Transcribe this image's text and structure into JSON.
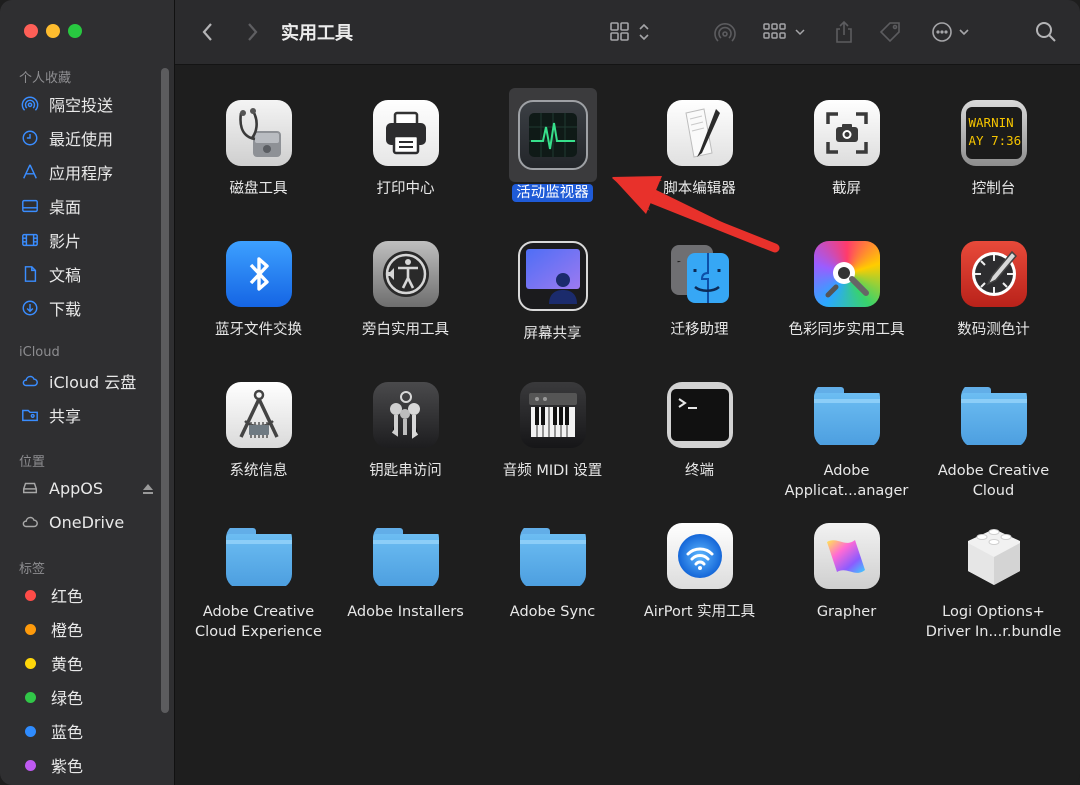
{
  "toolbar": {
    "title": "实用工具"
  },
  "sidebar": {
    "sections": {
      "favorites": "个人收藏",
      "icloud": "iCloud",
      "locations": "位置",
      "tags": "标签"
    },
    "favorites": [
      {
        "label": "隔空投送",
        "icon": "airdrop-icon"
      },
      {
        "label": "最近使用",
        "icon": "clock-icon"
      },
      {
        "label": "应用程序",
        "icon": "apps-icon"
      },
      {
        "label": "桌面",
        "icon": "desktop-icon"
      },
      {
        "label": "影片",
        "icon": "film-icon"
      },
      {
        "label": "文稿",
        "icon": "document-icon"
      },
      {
        "label": "下载",
        "icon": "download-icon"
      }
    ],
    "icloud": [
      {
        "label": "iCloud 云盘",
        "icon": "cloud-icon"
      },
      {
        "label": "共享",
        "icon": "shared-folder-icon"
      }
    ],
    "locations": [
      {
        "label": "AppOS",
        "icon": "disk-icon"
      },
      {
        "label": "OneDrive",
        "icon": "cloud-icon"
      }
    ],
    "tags": [
      {
        "label": "红色",
        "color": "#fe4c48"
      },
      {
        "label": "橙色",
        "color": "#fe9a0b"
      },
      {
        "label": "黄色",
        "color": "#fed60a"
      },
      {
        "label": "绿色",
        "color": "#31c748"
      },
      {
        "label": "蓝色",
        "color": "#2f8cff"
      },
      {
        "label": "紫色",
        "color": "#bf5af2"
      }
    ]
  },
  "items": [
    {
      "label": "磁盘工具",
      "icon": "disk-utility-icon"
    },
    {
      "label": "打印中心",
      "icon": "printer-icon"
    },
    {
      "label": "活动监视器",
      "icon": "activity-monitor-icon",
      "selected": true
    },
    {
      "label": "脚本编辑器",
      "icon": "script-editor-icon"
    },
    {
      "label": "截屏",
      "icon": "screenshot-icon"
    },
    {
      "label": "控制台",
      "icon": "console-icon",
      "screen_text_1": "WARNIN",
      "screen_text_2": "AY 7:36"
    },
    {
      "label": "蓝牙文件交换",
      "icon": "bluetooth-icon"
    },
    {
      "label": "旁白实用工具",
      "icon": "voiceover-icon"
    },
    {
      "label": "屏幕共享",
      "icon": "screen-sharing-icon"
    },
    {
      "label": "迁移助理",
      "icon": "migration-assistant-icon"
    },
    {
      "label": "色彩同步实用工具",
      "icon": "colorsync-icon"
    },
    {
      "label": "数码测色计",
      "icon": "digital-color-meter-icon"
    },
    {
      "label": "系统信息",
      "icon": "system-information-icon"
    },
    {
      "label": "钥匙串访问",
      "icon": "keychain-icon"
    },
    {
      "label": "音频 MIDI 设置",
      "icon": "audio-midi-icon"
    },
    {
      "label": "终端",
      "icon": "terminal-icon"
    },
    {
      "label": "Adobe Applicat...anager",
      "icon": "folder-icon"
    },
    {
      "label": "Adobe Creative Cloud",
      "icon": "folder-icon"
    },
    {
      "label": "Adobe Creative Cloud Experience",
      "icon": "folder-icon"
    },
    {
      "label": "Adobe Installers",
      "icon": "folder-icon"
    },
    {
      "label": "Adobe Sync",
      "icon": "folder-icon"
    },
    {
      "label": "AirPort 实用工具",
      "icon": "airport-utility-icon"
    },
    {
      "label": "Grapher",
      "icon": "grapher-icon"
    },
    {
      "label": "Logi Options+ Driver In...r.bundle",
      "icon": "bundle-icon"
    }
  ],
  "colors": {
    "selection": "#1f5bd7",
    "annotation_arrow": "#e8312b"
  }
}
